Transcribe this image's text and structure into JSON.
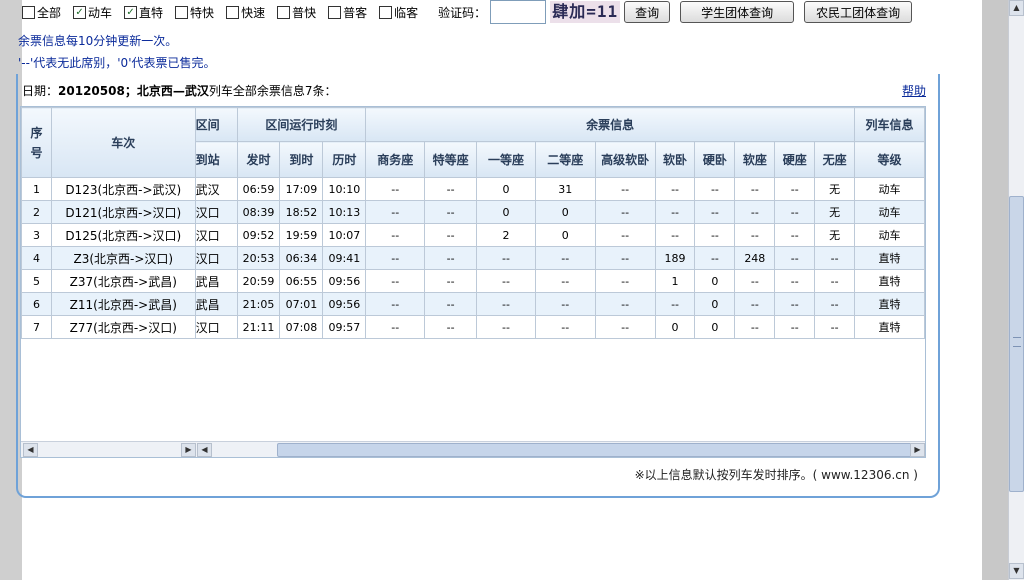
{
  "filters": {
    "items": [
      {
        "label": "全部",
        "checked": false
      },
      {
        "label": "动车",
        "checked": true
      },
      {
        "label": "直特",
        "checked": true
      },
      {
        "label": "特快",
        "checked": false
      },
      {
        "label": "快速",
        "checked": false
      },
      {
        "label": "普快",
        "checked": false
      },
      {
        "label": "普客",
        "checked": false
      },
      {
        "label": "临客",
        "checked": false
      }
    ],
    "captcha_label": "验证码：",
    "captcha_value": "",
    "captcha_image_text": "肆加=11",
    "query_button": "查询",
    "student_button": "学生团体查询",
    "migrant_button": "农民工团体查询"
  },
  "notes": {
    "line1": "余票信息每10分钟更新一次。",
    "line2": "'--'代表无此席别，'0'代表票已售完。"
  },
  "info": {
    "date_label": "日期：",
    "date": "20120508",
    "route": "北京西—武汉",
    "suffix": "列车全部余票信息7条：",
    "help": "帮助"
  },
  "table": {
    "group_headers": {
      "seq": "序号",
      "train": "车次",
      "arrive_group": "区间",
      "timing": "区间运行时刻",
      "remaining": "余票信息",
      "train_info": "列车信息"
    },
    "sub_headers": {
      "arrive_station": "到站",
      "depart": "发时",
      "arrive": "到时",
      "duration": "历时",
      "seats": [
        "商务座",
        "特等座",
        "一等座",
        "二等座",
        "高级软卧",
        "软卧",
        "硬卧",
        "软座",
        "硬座",
        "无座"
      ],
      "grade": "等级"
    },
    "rows": [
      {
        "seq": "1",
        "train": "D123(北京西->武汉)",
        "station": "武汉",
        "depart": "06:59",
        "arrive": "17:09",
        "duration": "10:10",
        "seats": [
          "--",
          "--",
          "0",
          "31",
          "--",
          "--",
          "--",
          "--",
          "--",
          "无"
        ],
        "grade": "动车"
      },
      {
        "seq": "2",
        "train": "D121(北京西->汉口)",
        "station": "汉口",
        "depart": "08:39",
        "arrive": "18:52",
        "duration": "10:13",
        "seats": [
          "--",
          "--",
          "0",
          "0",
          "--",
          "--",
          "--",
          "--",
          "--",
          "无"
        ],
        "grade": "动车"
      },
      {
        "seq": "3",
        "train": "D125(北京西->汉口)",
        "station": "汉口",
        "depart": "09:52",
        "arrive": "19:59",
        "duration": "10:07",
        "seats": [
          "--",
          "--",
          "2",
          "0",
          "--",
          "--",
          "--",
          "--",
          "--",
          "无"
        ],
        "grade": "动车"
      },
      {
        "seq": "4",
        "train": "Z3(北京西->汉口)",
        "station": "汉口",
        "depart": "20:53",
        "arrive": "06:34",
        "duration": "09:41",
        "seats": [
          "--",
          "--",
          "--",
          "--",
          "--",
          "189",
          "--",
          "248",
          "--",
          "--"
        ],
        "grade": "直特"
      },
      {
        "seq": "5",
        "train": "Z37(北京西->武昌)",
        "station": "武昌",
        "depart": "20:59",
        "arrive": "06:55",
        "duration": "09:56",
        "seats": [
          "--",
          "--",
          "--",
          "--",
          "--",
          "1",
          "0",
          "--",
          "--",
          "--"
        ],
        "grade": "直特"
      },
      {
        "seq": "6",
        "train": "Z11(北京西->武昌)",
        "station": "武昌",
        "depart": "21:05",
        "arrive": "07:01",
        "duration": "09:56",
        "seats": [
          "--",
          "--",
          "--",
          "--",
          "--",
          "--",
          "0",
          "--",
          "--",
          "--"
        ],
        "grade": "直特"
      },
      {
        "seq": "7",
        "train": "Z77(北京西->汉口)",
        "station": "汉口",
        "depart": "21:11",
        "arrive": "07:08",
        "duration": "09:57",
        "seats": [
          "--",
          "--",
          "--",
          "--",
          "--",
          "0",
          "0",
          "--",
          "--",
          "--"
        ],
        "grade": "直特"
      }
    ]
  },
  "footer": "※以上信息默认按列车发时排序。( www.12306.cn )"
}
